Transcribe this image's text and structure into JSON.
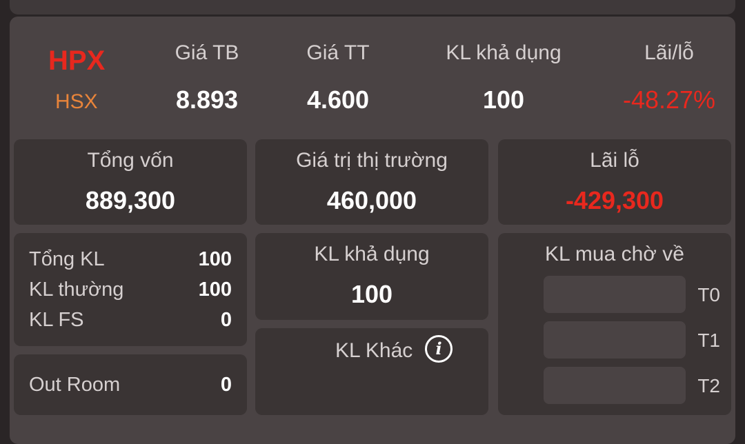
{
  "stock": {
    "ticker": "HPX",
    "exchange": "HSX",
    "avg_price_label": "Giá TB",
    "avg_price": "8.893",
    "market_price_label": "Giá TT",
    "market_price": "4.600",
    "available_qty_label": "KL khả dụng",
    "available_qty": "100",
    "pnl_pct_label": "Lãi/lỗ",
    "pnl_pct": "-48.27%"
  },
  "summary": {
    "total_capital_label": "Tổng vốn",
    "total_capital": "889,300",
    "market_value_label": "Giá trị thị trường",
    "market_value": "460,000",
    "pnl_label": "Lãi lỗ",
    "pnl": "-429,300"
  },
  "volume": {
    "total_label": "Tổng KL",
    "total": "100",
    "normal_label": "KL thường",
    "normal": "100",
    "fs_label": "KL FS",
    "fs": "0",
    "out_room_label": "Out Room",
    "out_room": "0"
  },
  "available": {
    "label": "KL khả dụng",
    "value": "100"
  },
  "other": {
    "label": "KL Khác",
    "icon": "info-icon"
  },
  "pending": {
    "label": "KL mua chờ về",
    "slots": [
      {
        "label": "T0"
      },
      {
        "label": "T1"
      },
      {
        "label": "T2"
      }
    ]
  },
  "colors": {
    "loss": "#e8281e",
    "exchange": "#e8843a",
    "card_bg": "#4a4344",
    "box_bg": "#3a3434"
  }
}
